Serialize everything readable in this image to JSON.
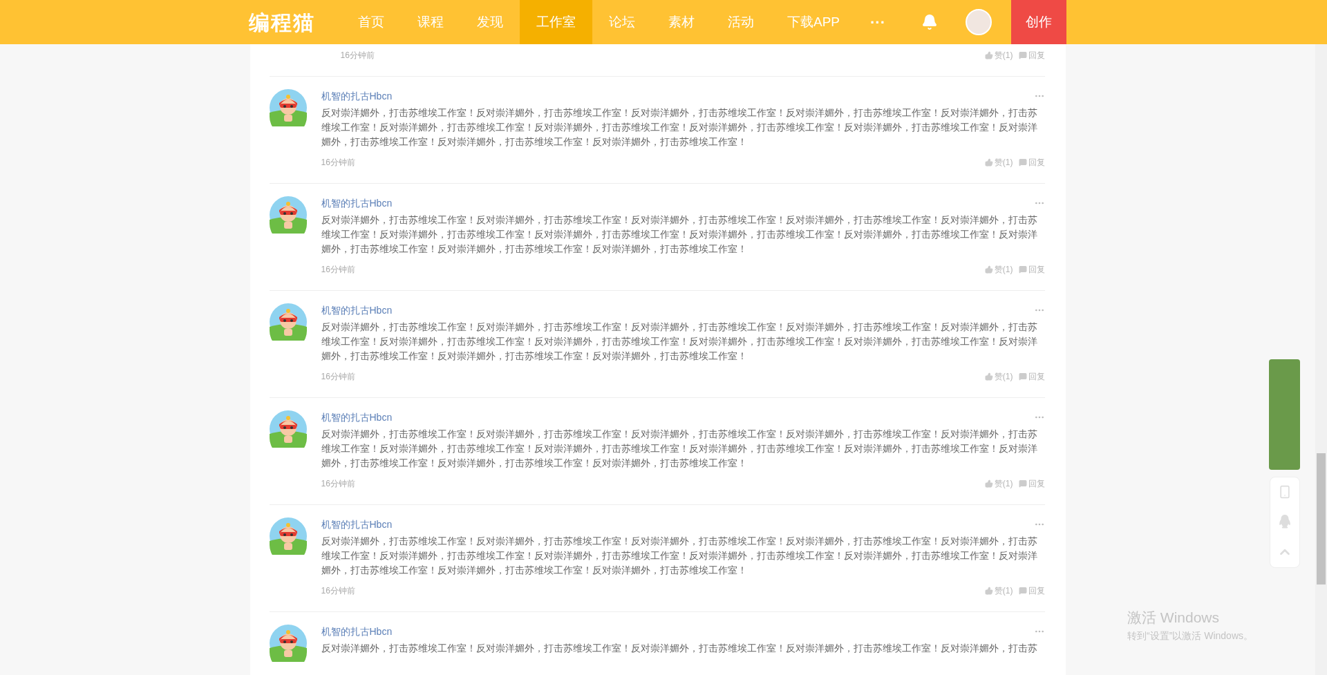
{
  "header": {
    "logo": "编程猫",
    "nav": [
      {
        "label": "首页",
        "selected": false
      },
      {
        "label": "课程",
        "selected": false
      },
      {
        "label": "发现",
        "selected": false
      },
      {
        "label": "工作室",
        "selected": true
      },
      {
        "label": "论坛",
        "selected": false
      },
      {
        "label": "素材",
        "selected": false
      },
      {
        "label": "活动",
        "selected": false
      },
      {
        "label": "下载APP",
        "selected": false
      }
    ],
    "more": "···",
    "create_button": "创作"
  },
  "comments": [
    {
      "time": "16分钟前",
      "like": "赞(1)",
      "reply": "回复"
    },
    {
      "author": "机智的扎古Hbcn",
      "text": "反对崇洋媚外，打击苏维埃工作室！反对崇洋媚外，打击苏维埃工作室！反对崇洋媚外，打击苏维埃工作室！反对崇洋媚外，打击苏维埃工作室！反对崇洋媚外，打击苏维埃工作室！反对崇洋媚外，打击苏维埃工作室！反对崇洋媚外，打击苏维埃工作室！反对崇洋媚外，打击苏维埃工作室！反对崇洋媚外，打击苏维埃工作室！反对崇洋媚外，打击苏维埃工作室！反对崇洋媚外，打击苏维埃工作室！反对崇洋媚外，打击苏维埃工作室！",
      "time": "16分钟前",
      "like": "赞(1)",
      "reply": "回复"
    },
    {
      "author": "机智的扎古Hbcn",
      "text": "反对崇洋媚外，打击苏维埃工作室！反对崇洋媚外，打击苏维埃工作室！反对崇洋媚外，打击苏维埃工作室！反对崇洋媚外，打击苏维埃工作室！反对崇洋媚外，打击苏维埃工作室！反对崇洋媚外，打击苏维埃工作室！反对崇洋媚外，打击苏维埃工作室！反对崇洋媚外，打击苏维埃工作室！反对崇洋媚外，打击苏维埃工作室！反对崇洋媚外，打击苏维埃工作室！反对崇洋媚外，打击苏维埃工作室！反对崇洋媚外，打击苏维埃工作室！",
      "time": "16分钟前",
      "like": "赞(1)",
      "reply": "回复"
    },
    {
      "author": "机智的扎古Hbcn",
      "text": "反对崇洋媚外，打击苏维埃工作室！反对崇洋媚外，打击苏维埃工作室！反对崇洋媚外，打击苏维埃工作室！反对崇洋媚外，打击苏维埃工作室！反对崇洋媚外，打击苏维埃工作室！反对崇洋媚外，打击苏维埃工作室！反对崇洋媚外，打击苏维埃工作室！反对崇洋媚外，打击苏维埃工作室！反对崇洋媚外，打击苏维埃工作室！反对崇洋媚外，打击苏维埃工作室！反对崇洋媚外，打击苏维埃工作室！反对崇洋媚外，打击苏维埃工作室！",
      "time": "16分钟前",
      "like": "赞(1)",
      "reply": "回复"
    },
    {
      "author": "机智的扎古Hbcn",
      "text": "反对崇洋媚外，打击苏维埃工作室！反对崇洋媚外，打击苏维埃工作室！反对崇洋媚外，打击苏维埃工作室！反对崇洋媚外，打击苏维埃工作室！反对崇洋媚外，打击苏维埃工作室！反对崇洋媚外，打击苏维埃工作室！反对崇洋媚外，打击苏维埃工作室！反对崇洋媚外，打击苏维埃工作室！反对崇洋媚外，打击苏维埃工作室！反对崇洋媚外，打击苏维埃工作室！反对崇洋媚外，打击苏维埃工作室！反对崇洋媚外，打击苏维埃工作室！",
      "time": "16分钟前",
      "like": "赞(1)",
      "reply": "回复"
    },
    {
      "author": "机智的扎古Hbcn",
      "text": "反对崇洋媚外，打击苏维埃工作室！反对崇洋媚外，打击苏维埃工作室！反对崇洋媚外，打击苏维埃工作室！反对崇洋媚外，打击苏维埃工作室！反对崇洋媚外，打击苏维埃工作室！反对崇洋媚外，打击苏维埃工作室！反对崇洋媚外，打击苏维埃工作室！反对崇洋媚外，打击苏维埃工作室！反对崇洋媚外，打击苏维埃工作室！反对崇洋媚外，打击苏维埃工作室！反对崇洋媚外，打击苏维埃工作室！反对崇洋媚外，打击苏维埃工作室！",
      "time": "16分钟前",
      "like": "赞(1)",
      "reply": "回复"
    },
    {
      "author": "机智的扎古Hbcn",
      "text": "反对崇洋媚外，打击苏维埃工作室！反对崇洋媚外，打击苏维埃工作室！反对崇洋媚外，打击苏维埃工作室！反对崇洋媚外，打击苏维埃工作室！反对崇洋媚外，打击苏"
    }
  ],
  "os_notice": {
    "title": "激活 Windows",
    "subtitle": "转到“设置”以激活 Windows。"
  }
}
